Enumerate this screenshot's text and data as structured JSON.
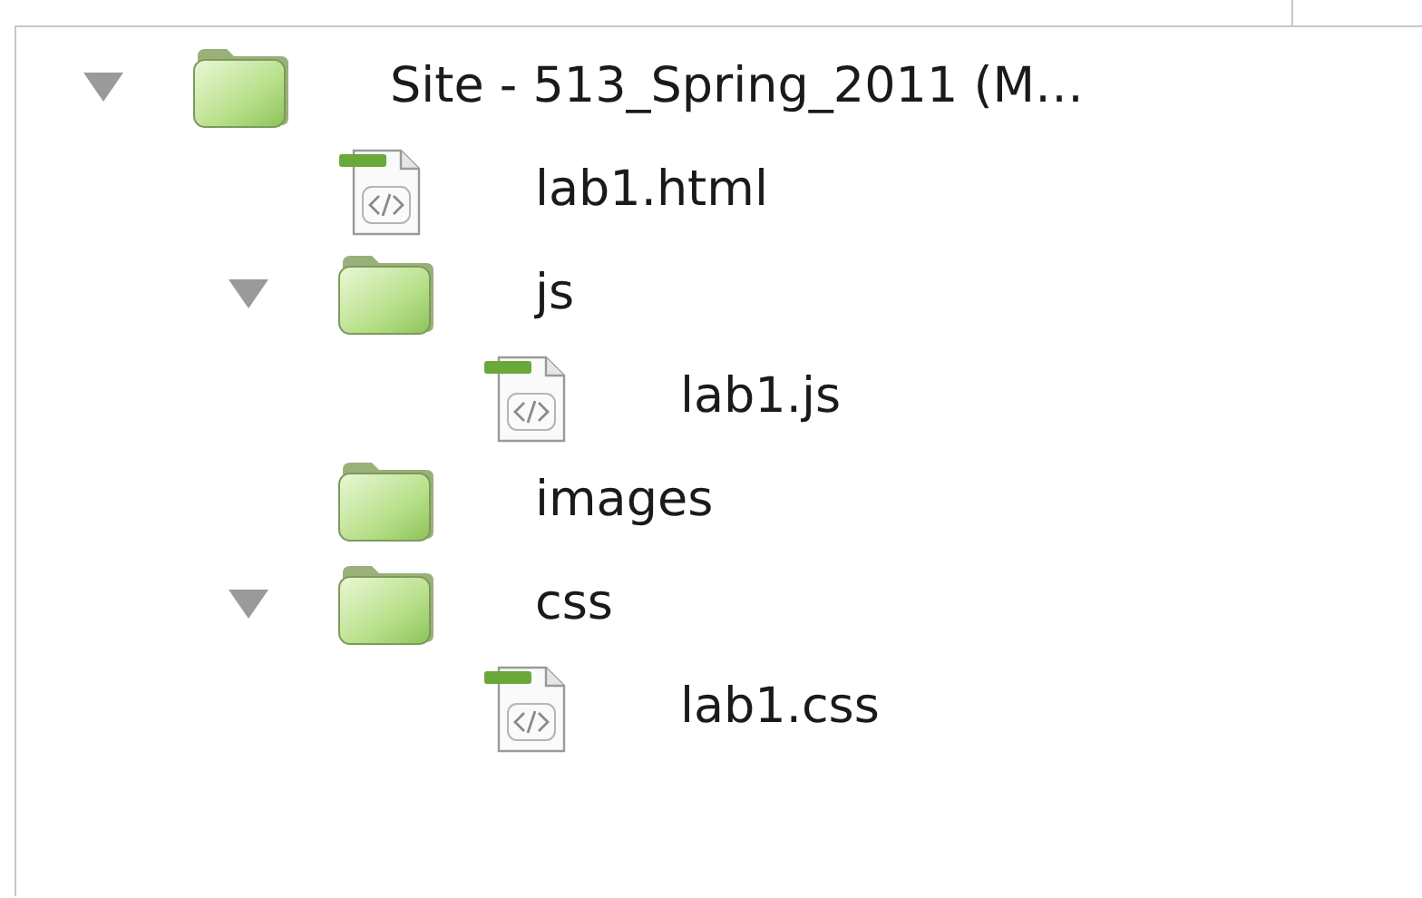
{
  "tree": [
    {
      "kind": "folder",
      "label": "Site - 513_Spring_2011 (M…",
      "expanded": true,
      "children": [
        {
          "kind": "file",
          "label": "lab1.html"
        },
        {
          "kind": "folder",
          "label": "js",
          "expanded": true,
          "children": [
            {
              "kind": "file",
              "label": "lab1.js"
            }
          ]
        },
        {
          "kind": "folder",
          "label": "images"
        },
        {
          "kind": "folder",
          "label": "css",
          "expanded": true,
          "children": [
            {
              "kind": "file",
              "label": "lab1.css"
            }
          ]
        }
      ]
    }
  ]
}
